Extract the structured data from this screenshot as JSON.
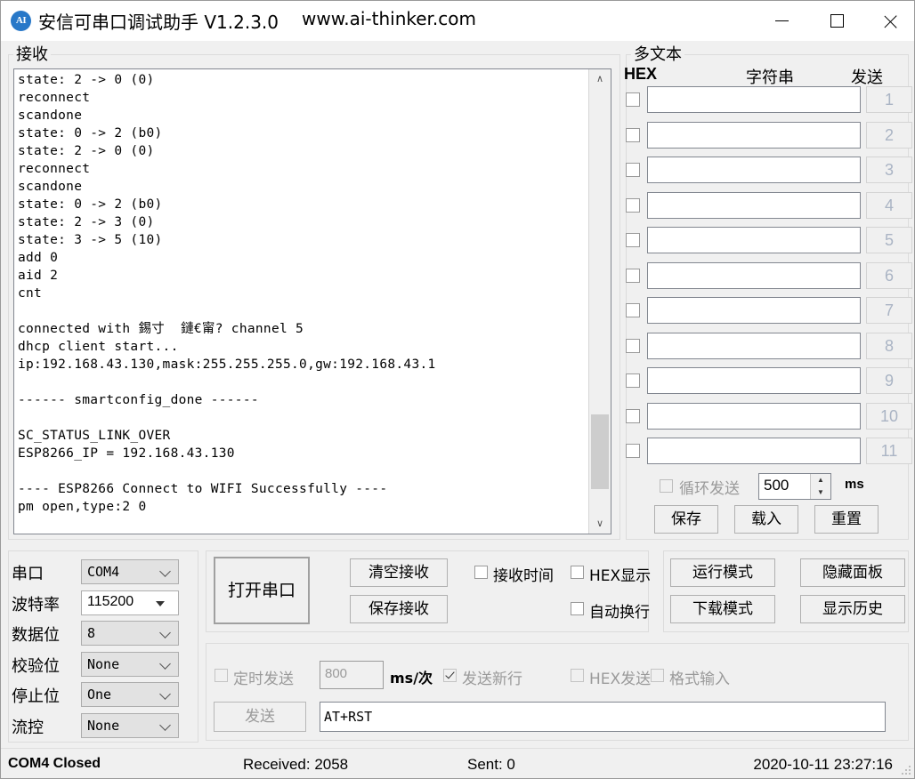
{
  "window": {
    "icon_text": "AI",
    "icon_name": "app-logo-icon",
    "title": "安信可串口调试助手 V1.2.3.0",
    "url": "www.ai-thinker.com",
    "minimize": "–",
    "maximize": "□",
    "close": "✕"
  },
  "receive": {
    "group_label": "接收",
    "text": "state: 2 -> 0 (0)\nreconnect\nscandone\nstate: 0 -> 2 (b0)\nstate: 2 -> 0 (0)\nreconnect\nscandone\nstate: 0 -> 2 (b0)\nstate: 2 -> 3 (0)\nstate: 3 -> 5 (10)\nadd 0\naid 2\ncnt\n\nconnected with 錫寸  鏈€甯? channel 5\ndhcp client start...\nip:192.168.43.130,mask:255.255.255.0,gw:192.168.43.1\n\n------ smartconfig_done ------\n\nSC_STATUS_LINK_OVER\nESP8266_IP = 192.168.43.130\n\n---- ESP8266 Connect to WIFI Successfully ----\npm open,type:2 0",
    "scroll_up": "∧",
    "scroll_down": "∨"
  },
  "multitext": {
    "group_label": "多文本",
    "col_hex": "HEX",
    "col_string": "字符串",
    "col_send": "发送",
    "rows": [
      {
        "index": "1",
        "value": ""
      },
      {
        "index": "2",
        "value": ""
      },
      {
        "index": "3",
        "value": ""
      },
      {
        "index": "4",
        "value": ""
      },
      {
        "index": "5",
        "value": ""
      },
      {
        "index": "6",
        "value": ""
      },
      {
        "index": "7",
        "value": ""
      },
      {
        "index": "8",
        "value": ""
      },
      {
        "index": "9",
        "value": ""
      },
      {
        "index": "10",
        "value": ""
      },
      {
        "index": "11",
        "value": ""
      }
    ],
    "loop_send_label": "循环发送",
    "loop_send_value": "500",
    "loop_send_unit": "ms",
    "spin_up": "▲",
    "spin_down": "▼",
    "btn_save": "保存",
    "btn_load": "载入",
    "btn_reset": "重置"
  },
  "serial": {
    "rows": [
      {
        "label": "串口",
        "value": "COM4",
        "editable": false
      },
      {
        "label": "波特率",
        "value": "115200",
        "editable": true
      },
      {
        "label": "数据位",
        "value": "8",
        "editable": false
      },
      {
        "label": "校验位",
        "value": "None",
        "editable": false
      },
      {
        "label": "停止位",
        "value": "One",
        "editable": false
      },
      {
        "label": "流控",
        "value": "None",
        "editable": false
      }
    ]
  },
  "controls": {
    "open_port": "打开串口",
    "clear_receive": "清空接收",
    "save_receive": "保存接收",
    "cb_recv_time": "接收时间",
    "cb_hex_show": "HEX显示",
    "cb_auto_wrap": "自动换行"
  },
  "modes": {
    "run_mode": "运行模式",
    "download_mode": "下载模式",
    "hide_panel": "隐藏面板",
    "show_history": "显示历史"
  },
  "send": {
    "cb_timed_send": "定时发送",
    "timed_value": "800",
    "timed_unit": "ms/次",
    "cb_send_newline": "发送新行",
    "cb_hex_send": "HEX发送",
    "cb_format_input": "格式输入",
    "send_button": "发送",
    "input_value": "AT+RST"
  },
  "status": {
    "port_state": "COM4 Closed",
    "received": "Received: 2058",
    "sent": "Sent: 0",
    "datetime": "2020-10-11 23:27:16"
  },
  "colors": {
    "accent": "#2878c8",
    "window_bg": "#f0f0f0",
    "field_bg": "#ffffff",
    "disabled_text": "#9a9a9a"
  }
}
